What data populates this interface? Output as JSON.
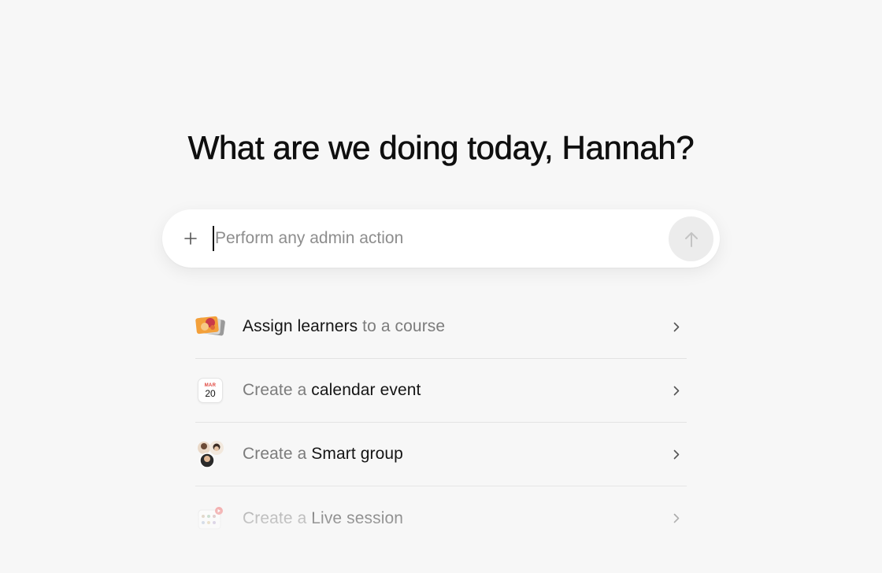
{
  "greeting": "What are we doing today, Hannah?",
  "composer": {
    "placeholder": "Perform any admin action",
    "value": ""
  },
  "actions": [
    {
      "icon": "course-thumbnail-icon",
      "parts": [
        {
          "text": "Assign learners",
          "tone": "dark"
        },
        {
          "text": " to a course",
          "tone": "muted"
        }
      ]
    },
    {
      "icon": "calendar-icon",
      "calendar": {
        "month": "MAR",
        "day": "20"
      },
      "parts": [
        {
          "text": "Create a ",
          "tone": "muted"
        },
        {
          "text": "calendar event",
          "tone": "dark"
        }
      ]
    },
    {
      "icon": "people-group-icon",
      "parts": [
        {
          "text": "Create a ",
          "tone": "muted"
        },
        {
          "text": "Smart group",
          "tone": "dark"
        }
      ]
    },
    {
      "icon": "live-session-icon",
      "parts": [
        {
          "text": "Create a ",
          "tone": "muted"
        },
        {
          "text": "Live session",
          "tone": "dark"
        }
      ]
    }
  ],
  "colors": {
    "background": "#f7f7f7",
    "text_dark": "#151515",
    "text_muted": "#7c7c7c",
    "send_button": "#ececec",
    "live_dot": "#f07f7f"
  }
}
